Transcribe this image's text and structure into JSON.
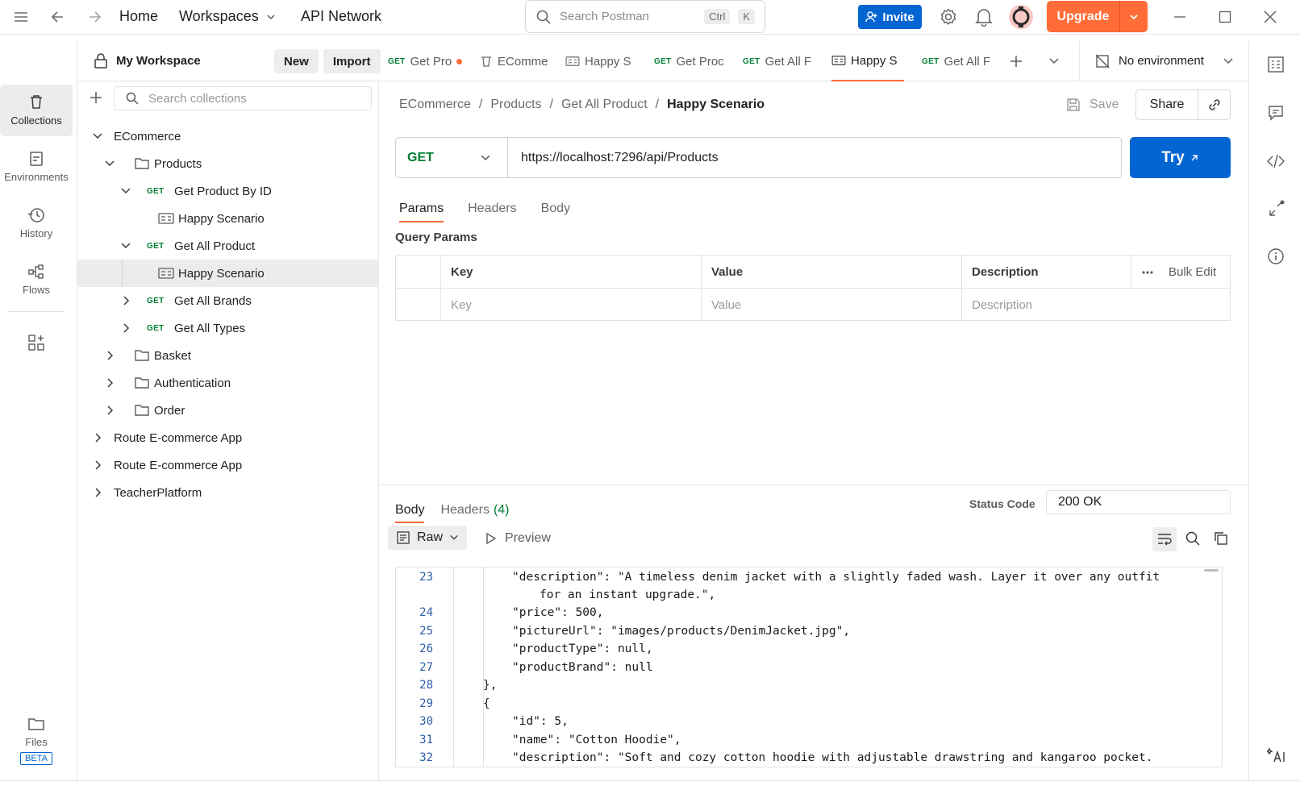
{
  "topbar": {
    "home": "Home",
    "workspaces": "Workspaces",
    "api_network": "API Network",
    "search_placeholder": "Search Postman",
    "shortcut_ctrl": "Ctrl",
    "shortcut_k": "K",
    "invite": "Invite",
    "upgrade": "Upgrade"
  },
  "rail": {
    "collections": "Collections",
    "environments": "Environments",
    "history": "History",
    "flows": "Flows",
    "files": "Files",
    "beta": "BETA"
  },
  "workspace": {
    "name": "My Workspace",
    "new": "New",
    "import": "Import",
    "search_placeholder": "Search collections"
  },
  "tree": {
    "ecommerce": "ECommerce",
    "products": "Products",
    "get_product_by_id": "Get Product By ID",
    "happy_scenario_1": "Happy Scenario",
    "get_all_product": "Get All Product",
    "happy_scenario_2": "Happy Scenario",
    "get_all_brands": "Get All Brands",
    "get_all_types": "Get All Types",
    "basket": "Basket",
    "authentication": "Authentication",
    "order": "Order",
    "route_1": "Route E-commerce App",
    "route_2": "Route E-commerce App",
    "teacher_platform": "TeacherPlatform",
    "method_get": "GET"
  },
  "tabs": {
    "t1": "Get Pro",
    "t2": "EComme",
    "t3": "Happy S",
    "t4": "Get Proc",
    "t5": "Get All F",
    "t6": "Happy S",
    "t7": "Get All F",
    "method": "GET",
    "environment": "No environment"
  },
  "breadcrumb": {
    "c1": "ECommerce",
    "c2": "Products",
    "c3": "Get All Product",
    "current": "Happy Scenario",
    "sep": "/",
    "save": "Save",
    "share": "Share"
  },
  "request": {
    "method": "GET",
    "url": "https://localhost:7296/api/Products",
    "try": "Try"
  },
  "request_tabs": {
    "params": "Params",
    "headers": "Headers",
    "body": "Body"
  },
  "query_params": {
    "title": "Query Params",
    "col_key": "Key",
    "col_value": "Value",
    "col_description": "Description",
    "bulk_edit": "Bulk Edit",
    "ph_key": "Key",
    "ph_value": "Value",
    "ph_description": "Description"
  },
  "response": {
    "body_tab": "Body",
    "headers_tab": "Headers",
    "headers_count": "(4)",
    "status_label": "Status Code",
    "status_value": "200 OK",
    "format": "Raw",
    "preview": "Preview"
  },
  "code": {
    "l23": "23",
    "l24": "24",
    "l25": "25",
    "l26": "26",
    "l27": "27",
    "l28": "28",
    "l29": "29",
    "l30": "30",
    "l31": "31",
    "l32": "32",
    "c23a": "\"description\": \"A timeless denim jacket with a slightly faded wash. Layer it over any outfit",
    "c23b": "for an instant upgrade.\",",
    "c24": "\"price\": 500,",
    "c25": "\"pictureUrl\": \"images/products/DenimJacket.jpg\",",
    "c26": "\"productType\": null,",
    "c27": "\"productBrand\": null",
    "c28": "},",
    "c29": "{",
    "c30": "\"id\": 5,",
    "c31": "\"name\": \"Cotton Hoodie\",",
    "c32": "\"description\": \"Soft and cozy cotton hoodie with adjustable drawstring and kangaroo pocket."
  },
  "colors": {
    "accent": "#ff6c37",
    "primary": "#0265d2",
    "get": "#007f31"
  }
}
